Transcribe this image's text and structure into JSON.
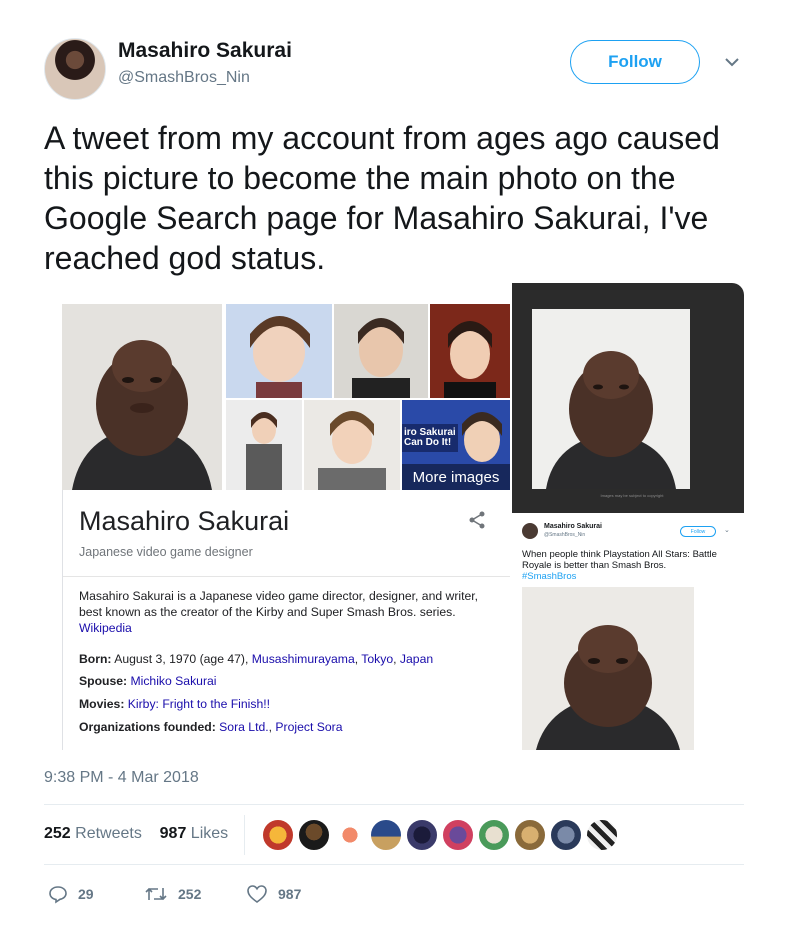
{
  "tweet": {
    "author_name": "Masahiro Sakurai",
    "author_handle": "@SmashBros_Nin",
    "follow_label": "Follow",
    "text": "A tweet from my account from ages ago caused this picture to become the main photo on the Google Search page for Masahiro Sakurai, I've reached god status.",
    "timestamp": "9:38 PM - 4 Mar 2018",
    "retweets_count": "252",
    "retweets_label": "Retweets",
    "likes_count": "987",
    "likes_label": "Likes",
    "reply_count": "29",
    "retweet_action_count": "252",
    "like_action_count": "987"
  },
  "google_panel": {
    "more_images": "More images",
    "title": "Masahiro Sakurai",
    "subtitle": "Japanese video game designer",
    "description": "Masahiro Sakurai is a Japanese video game director, designer, and writer, best known as the creator of the Kirby and Super Smash Bros. series.",
    "wiki_link": "Wikipedia",
    "born_label": "Born:",
    "born_value": "August 3, 1970 (age 47),",
    "born_place_1": "Musashimurayama",
    "born_place_2": "Tokyo",
    "born_place_3": "Japan",
    "spouse_label": "Spouse:",
    "spouse_value": "Michiko Sakurai",
    "movies_label": "Movies:",
    "movies_value": "Kirby: Fright to the Finish!!",
    "orgs_label": "Organizations founded:",
    "orgs_value_1": "Sora Ltd.",
    "orgs_value_2": "Project Sora",
    "thumb_banner_text": "iro Sakurai Can Do It!"
  },
  "dark_panel": {
    "caption": "Images may be subject to copyright"
  },
  "mini_tweet": {
    "name": "Masahiro Sakurai",
    "handle": "@SmashBros_Nin",
    "follow": "Follow",
    "text": "When people think Playstation All Stars: Battle Royale is better than Smash Bros.",
    "hashtag": "#SmashBros"
  },
  "colors": {
    "twitter_blue": "#1da1f2",
    "google_link": "#1a0dab",
    "muted": "#657786"
  },
  "icons": [
    "chevron-down-icon",
    "share-icon",
    "reply-icon",
    "retweet-icon",
    "heart-icon"
  ]
}
